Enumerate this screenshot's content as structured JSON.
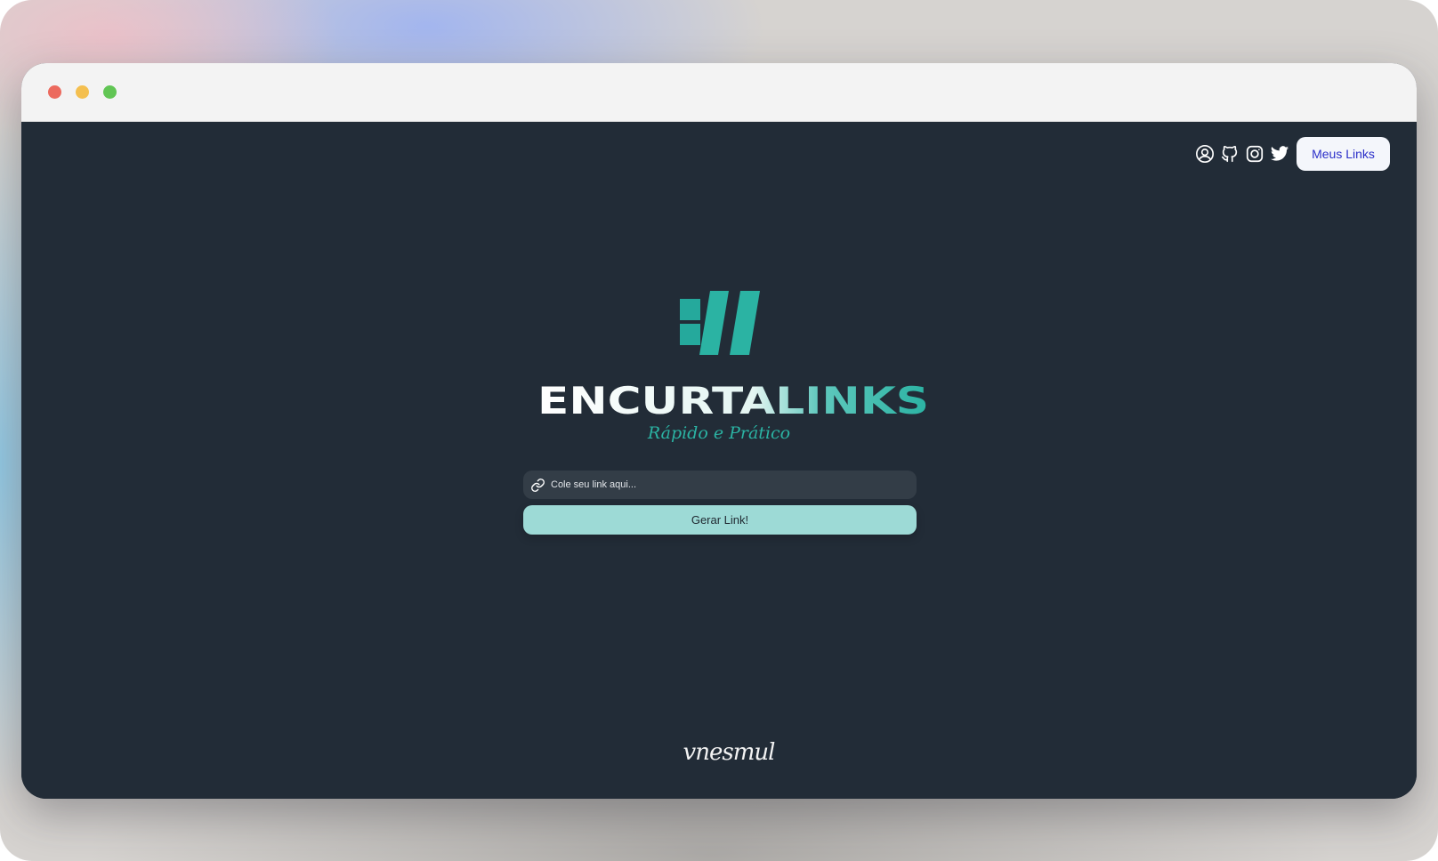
{
  "window": {
    "controls": [
      "close",
      "minimize",
      "zoom"
    ]
  },
  "nav": {
    "icons": [
      "user-circle-icon",
      "github-icon",
      "instagram-icon",
      "twitter-icon"
    ],
    "meus_links_label": "Meus Links"
  },
  "hero": {
    "logo_text": "ENCURTALINKS",
    "tagline": "Rápido e Prático"
  },
  "form": {
    "placeholder": "Cole seu link aqui...",
    "value": "",
    "submit_label": "Gerar Link!"
  },
  "footer": {
    "signature": "vnesmul"
  },
  "colors": {
    "page_bg": "#222c37",
    "accent_teal": "#2bb3a3",
    "button_bg": "#9ddad6",
    "field_bg": "#333d47",
    "nav_button_text": "#2b2fc9"
  }
}
